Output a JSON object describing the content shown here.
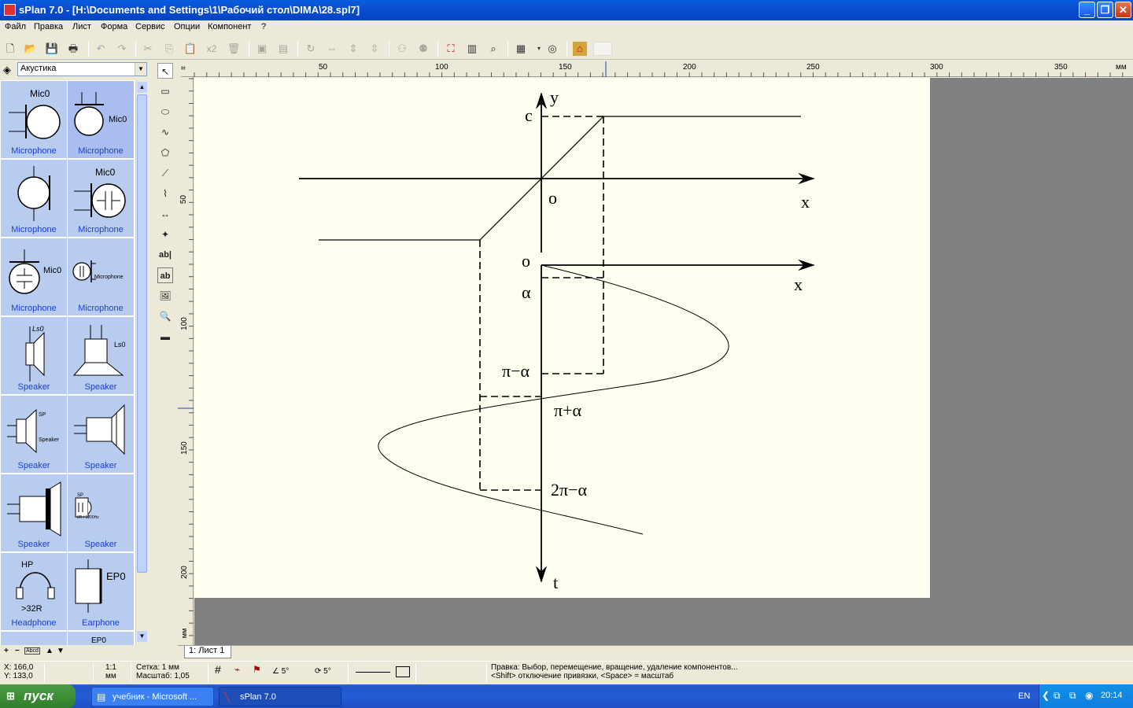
{
  "window": {
    "title": "sPlan 7.0 - [H:\\Documents and Settings\\1\\Рабочий стол\\DIMA\\28.spl7]",
    "minimize": "_",
    "restore": "❐",
    "close": "✕"
  },
  "menu": [
    "Файл",
    "Правка",
    "Лист",
    "Форма",
    "Сервис",
    "Опции",
    "Компонент",
    "?"
  ],
  "toolbar": {
    "times2_label": "x2"
  },
  "library": {
    "selected_category": "Акустика",
    "items": [
      {
        "label": "Microphone",
        "tag": "Mic0",
        "icon": "microphone-icon"
      },
      {
        "label": "Microphone",
        "tag": "Mic0",
        "icon": "microphone-icon"
      },
      {
        "label": "Microphone",
        "tag": "",
        "icon": "microphone-icon"
      },
      {
        "label": "Microphone",
        "tag": "Mic0",
        "icon": "microphone-capacitor-icon"
      },
      {
        "label": "Microphone",
        "tag": "Mic0",
        "icon": "microphone-capacitor-icon"
      },
      {
        "label": "Microphone",
        "tag": "Microphone",
        "icon": "microphone-capacitor-icon"
      },
      {
        "label": "Speaker",
        "tag": "Ls0",
        "icon": "speaker-icon"
      },
      {
        "label": "Speaker",
        "tag": "Ls0",
        "icon": "speaker-icon"
      },
      {
        "label": "Speaker",
        "tag": "SP",
        "tag2": "Speaker",
        "icon": "speaker-icon"
      },
      {
        "label": "Speaker",
        "tag": "",
        "icon": "speaker-icon"
      },
      {
        "label": "Speaker",
        "tag": "",
        "icon": "speaker-icon"
      },
      {
        "label": "Speaker",
        "tag": "SP",
        "tag2": "8R / 1200Hz",
        "icon": "buzzer-icon"
      },
      {
        "label": "Headphone",
        "tag": "HP",
        "tag2": ">32R",
        "icon": "headphone-icon"
      },
      {
        "label": "Earphone",
        "tag": "EP0",
        "icon": "earphone-icon"
      }
    ],
    "partial_next_tag": "EP0",
    "tools_label": "Abcd"
  },
  "rulers": {
    "unit": "мм",
    "h_ticks": [
      "50",
      "100",
      "150",
      "200",
      "250",
      "300",
      "350"
    ],
    "v_ticks": [
      "50",
      "100",
      "150",
      "200"
    ]
  },
  "drawing": {
    "labels": {
      "y": "y",
      "c": "c",
      "o_top": "o",
      "x_top": "x",
      "o_bottom": "o",
      "x_bottom": "x",
      "alpha": "α",
      "pi_minus_alpha": "π−α",
      "pi_plus_alpha": "π+α",
      "two_pi_minus_alpha": "2π−α",
      "t": "t"
    }
  },
  "sheet_tab": "1: Лист 1",
  "status": {
    "x_coord": "X: 166,0",
    "y_coord": "Y: 133,0",
    "ratio_top": "1:1",
    "ratio_unit": "мм",
    "grid": "Сетка: 1 мм",
    "scale": "Масштаб:  1,05",
    "angle1": "5°",
    "angle2": "5°",
    "hint1": "Правка: Выбор, перемещение, вращение, удаление компонентов...",
    "hint2": "<Shift> отключение привязки, <Space> =  масштаб"
  },
  "taskbar": {
    "start": "пуск",
    "items": [
      "учебник - Microsoft ...",
      "sPlan 7.0"
    ],
    "lang": "EN",
    "clock": "20:14"
  }
}
